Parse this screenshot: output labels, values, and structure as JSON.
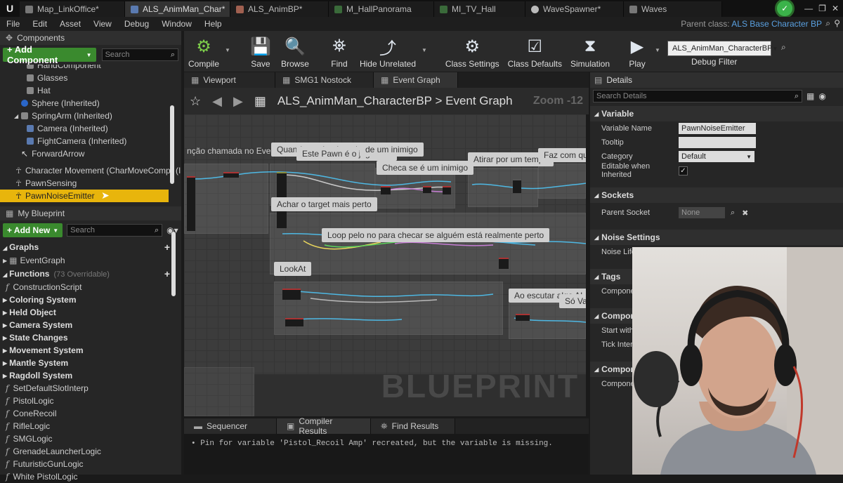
{
  "titlebar": {
    "tabs": [
      {
        "label": "Map_LinkOffice*",
        "active": false
      },
      {
        "label": "ALS_AnimMan_Char*",
        "active": true
      },
      {
        "label": "ALS_AnimBP*",
        "active": false
      },
      {
        "label": "M_HallPanorama",
        "active": false
      },
      {
        "label": "MI_TV_Hall",
        "active": false
      },
      {
        "label": "WaveSpawner*",
        "active": false
      },
      {
        "label": "Waves",
        "active": false
      }
    ]
  },
  "menubar": {
    "items": [
      "File",
      "Edit",
      "Asset",
      "View",
      "Debug",
      "Window",
      "Help"
    ],
    "parent_class_label": "Parent class:",
    "parent_class_value": "ALS Base Character BP"
  },
  "toolbar": {
    "compile": "Compile",
    "save": "Save",
    "browse": "Browse",
    "find": "Find",
    "hide_unrelated": "Hide Unrelated",
    "class_settings": "Class Settings",
    "class_defaults": "Class Defaults",
    "simulation": "Simulation",
    "play": "Play",
    "debug_object": "ALS_AnimMan_CharacterBP",
    "debug_filter": "Debug Filter"
  },
  "components": {
    "header": "Components",
    "add_button": "+ Add Component",
    "search_placeholder": "Search",
    "items": [
      "HandComponent",
      "Glasses",
      "Hat",
      "Sphere (Inherited)",
      "SpringArm (Inherited)",
      "Camera (Inherited)",
      "FightCamera (Inherited)",
      "ForwardArrow",
      "Character Movement (CharMoveComp) (In",
      "PawnSensing",
      "PawnNoiseEmitter"
    ],
    "selected": "PawnNoiseEmitter"
  },
  "my_blueprint": {
    "header": "My Blueprint",
    "add_button": "+ Add New",
    "search_placeholder": "Search",
    "graphs_label": "Graphs",
    "event_graph": "EventGraph",
    "functions_label": "Functions",
    "functions_overridable": "(73 Overridable)",
    "functions": [
      {
        "label": "ConstructionScript",
        "kind": "fn"
      },
      {
        "label": "Coloring System",
        "kind": "cat"
      },
      {
        "label": "Held Object",
        "kind": "cat"
      },
      {
        "label": "Camera System",
        "kind": "cat"
      },
      {
        "label": "State Changes",
        "kind": "cat"
      },
      {
        "label": "Movement System",
        "kind": "cat"
      },
      {
        "label": "Mantle System",
        "kind": "cat"
      },
      {
        "label": "Ragdoll System",
        "kind": "cat"
      },
      {
        "label": "SetDefaultSlotInterp",
        "kind": "fn"
      },
      {
        "label": "PistolLogic",
        "kind": "fn"
      },
      {
        "label": "ConeRecoil",
        "kind": "fn"
      },
      {
        "label": "RifleLogic",
        "kind": "fn"
      },
      {
        "label": "SMGLogic",
        "kind": "fn"
      },
      {
        "label": "GrenadeLauncherLogic",
        "kind": "fn"
      },
      {
        "label": "FuturisticGunLogic",
        "kind": "fn"
      },
      {
        "label": "White PistolLogic",
        "kind": "fn"
      }
    ]
  },
  "graph_tabs": [
    "Viewport",
    "SMG1 Nostock",
    "Event Graph"
  ],
  "graph_nav": {
    "blueprint": "ALS_AnimMan_CharacterBP",
    "separator": ">",
    "graph": "Event Graph",
    "zoom": "Zoom -12"
  },
  "graph": {
    "comments": [
      "nção chamada no Event Tic",
      "Quando ouvir o jogador",
      "Este Pawn é o jogador?",
      "de um inimigo",
      "Checa se é um inimigo",
      "Atirar por um tempo",
      "Faz com qu",
      "Achar o target mais perto",
      "Loop pelo no para checar se alguém está realmente perto",
      "LookAt",
      "Ao escutar algo AI",
      "Só Vai"
    ],
    "watermark": "BLUEPRINT"
  },
  "bottom": {
    "tabs": [
      "Sequencer",
      "Compiler Results",
      "Find Results"
    ],
    "log": "• Pin for variable 'Pistol_Recoil Amp' recreated, but the variable is missing."
  },
  "details": {
    "header": "Details",
    "search_placeholder": "Search Details",
    "sections": {
      "variable": "Variable",
      "sockets": "Sockets",
      "noise": "Noise Settings",
      "tags": "Tags",
      "component_tick": "Compone",
      "component_repl": "Compone"
    },
    "props": {
      "variable_name_label": "Variable Name",
      "variable_name": "PawnNoiseEmitter",
      "tooltip_label": "Tooltip",
      "category_label": "Category",
      "category": "Default",
      "editable_label": "Editable when Inherited",
      "parent_socket_label": "Parent Socket",
      "parent_socket": "None",
      "noise_life_label": "Noise Life",
      "tags_component_label": "Componer",
      "start_with_label": "Start with",
      "tick_interval_label": "Tick Interv",
      "component_label": "Componer"
    }
  }
}
